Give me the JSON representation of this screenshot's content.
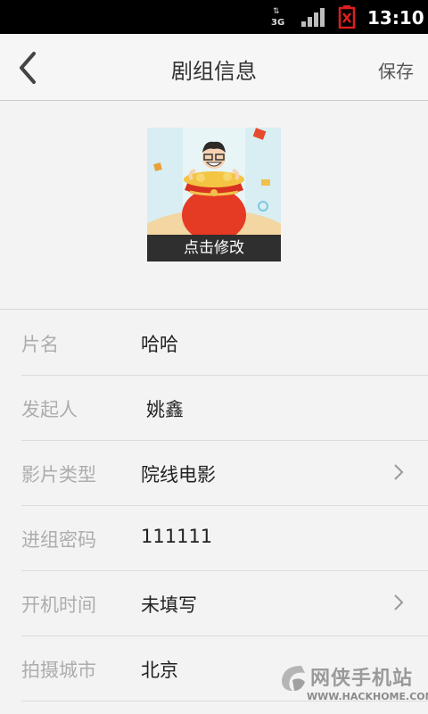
{
  "status_bar": {
    "network": "3G",
    "time": "13:10"
  },
  "header": {
    "back_icon": "chevron-left-icon",
    "title": "剧组信息",
    "save_label": "保存"
  },
  "avatar": {
    "edit_label": "点击修改"
  },
  "form": {
    "rows": [
      {
        "label": "片名",
        "value": "哈哈",
        "chevron": false
      },
      {
        "label": "发起人",
        "value": "姚鑫",
        "chevron": false
      },
      {
        "label": "影片类型",
        "value": "院线电影",
        "chevron": true
      },
      {
        "label": "进组密码",
        "value": "111111",
        "chevron": false
      },
      {
        "label": "开机时间",
        "value": "未填写",
        "chevron": true
      },
      {
        "label": "拍摄城市",
        "value": "北京",
        "chevron": false
      }
    ]
  },
  "watermark": {
    "name": "网侠手机站",
    "url": "WWW.HACKHOME.COM"
  }
}
